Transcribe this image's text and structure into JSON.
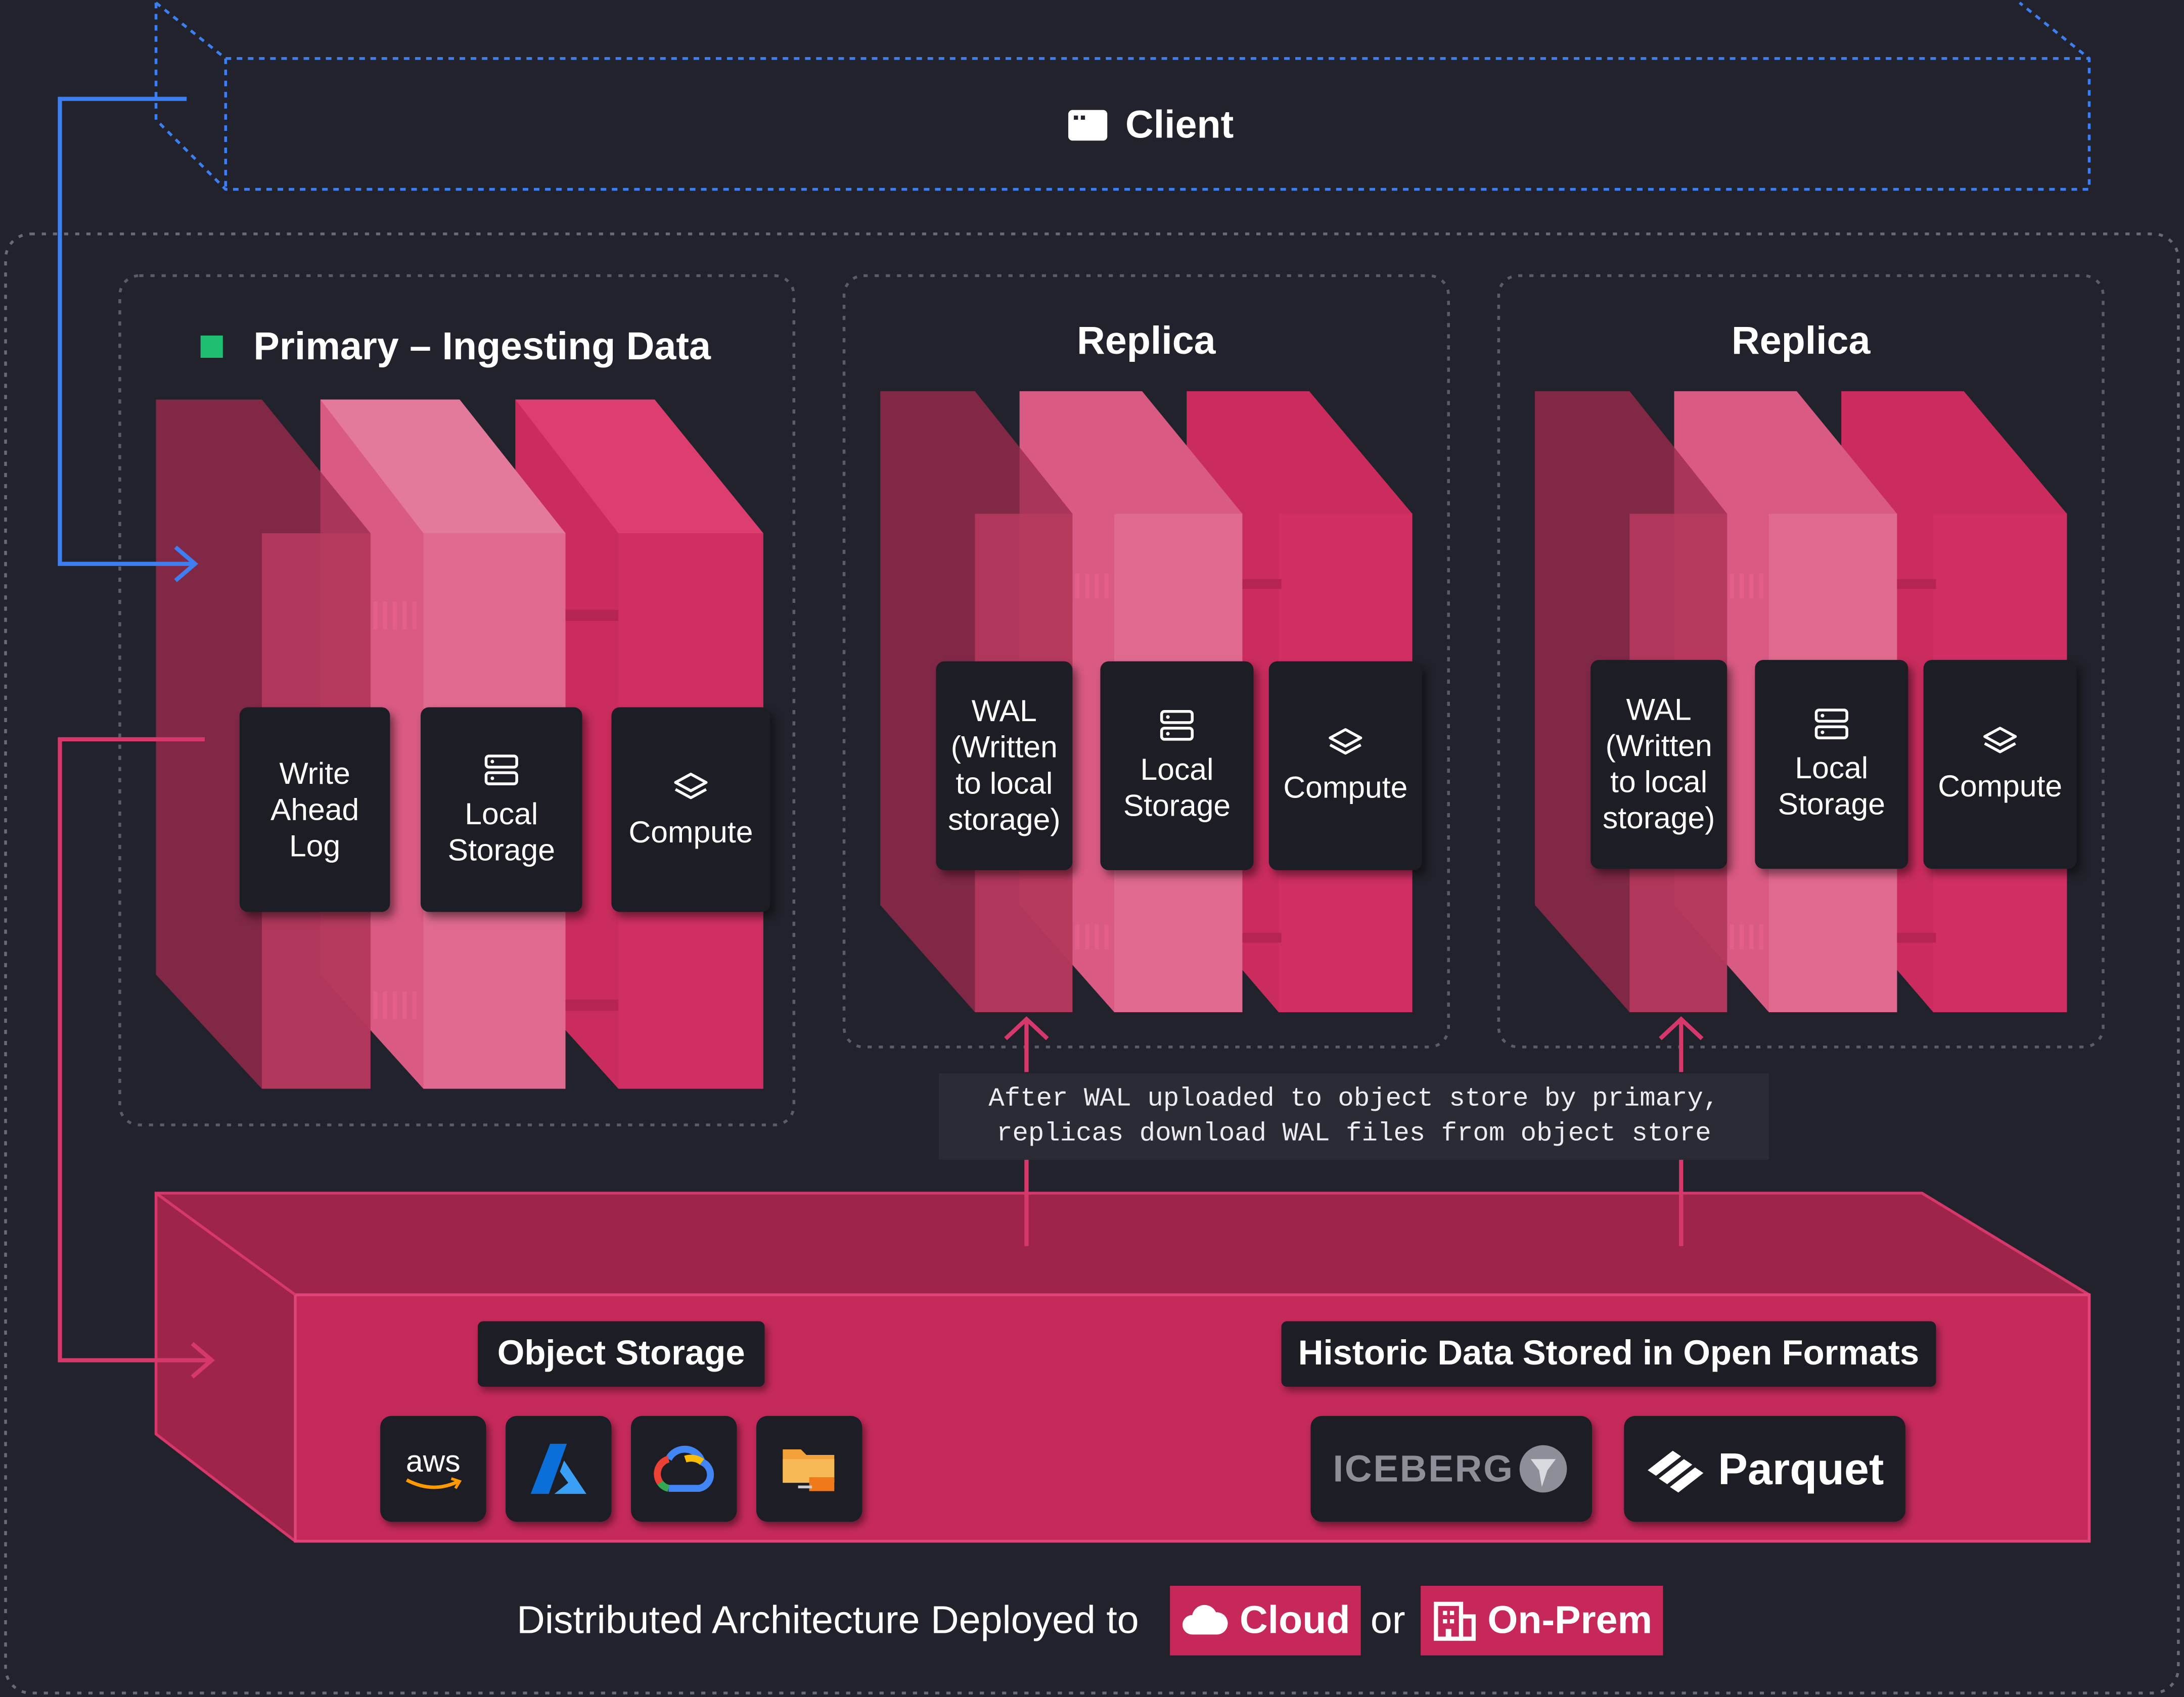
{
  "client": {
    "label": "Client",
    "icon": "window-icon"
  },
  "primary": {
    "title": "Primary – Ingesting Data",
    "status_color": "#1fbf72",
    "cards": [
      {
        "label": "Write Ahead Log"
      },
      {
        "label": "Local Storage",
        "icon": "storage-icon"
      },
      {
        "label": "Compute",
        "icon": "layers-icon"
      }
    ]
  },
  "replicas": [
    {
      "title": "Replica",
      "cards": [
        {
          "label": "WAL (Written to local storage)"
        },
        {
          "label": "Local Storage",
          "icon": "storage-icon"
        },
        {
          "label": "Compute",
          "icon": "layers-icon"
        }
      ]
    },
    {
      "title": "Replica",
      "cards": [
        {
          "label": "WAL (Written to local storage)"
        },
        {
          "label": "Local Storage",
          "icon": "storage-icon"
        },
        {
          "label": "Compute",
          "icon": "layers-icon"
        }
      ]
    }
  ],
  "note": {
    "line1": "After WAL uploaded to object store by primary,",
    "line2": "replicas download WAL files from object store"
  },
  "object_storage": {
    "label": "Object Storage",
    "providers": [
      {
        "name": "aws",
        "icon": "aws-icon"
      },
      {
        "name": "azure",
        "icon": "azure-icon"
      },
      {
        "name": "gcp",
        "icon": "google-cloud-icon"
      },
      {
        "name": "nfs",
        "icon": "nfs-folder-icon"
      }
    ]
  },
  "historic": {
    "label": "Historic Data Stored in Open Formats",
    "iceberg": "ICEBERG",
    "parquet": "Parquet"
  },
  "footer": {
    "prefix": "Distributed Architecture Deployed to",
    "cloud": "Cloud",
    "or": "or",
    "onprem": "On-Prem"
  },
  "colors": {
    "background": "#22222c",
    "accent": "#c7285a",
    "client_line": "#3d7ff0",
    "card": "#1d1d25"
  }
}
